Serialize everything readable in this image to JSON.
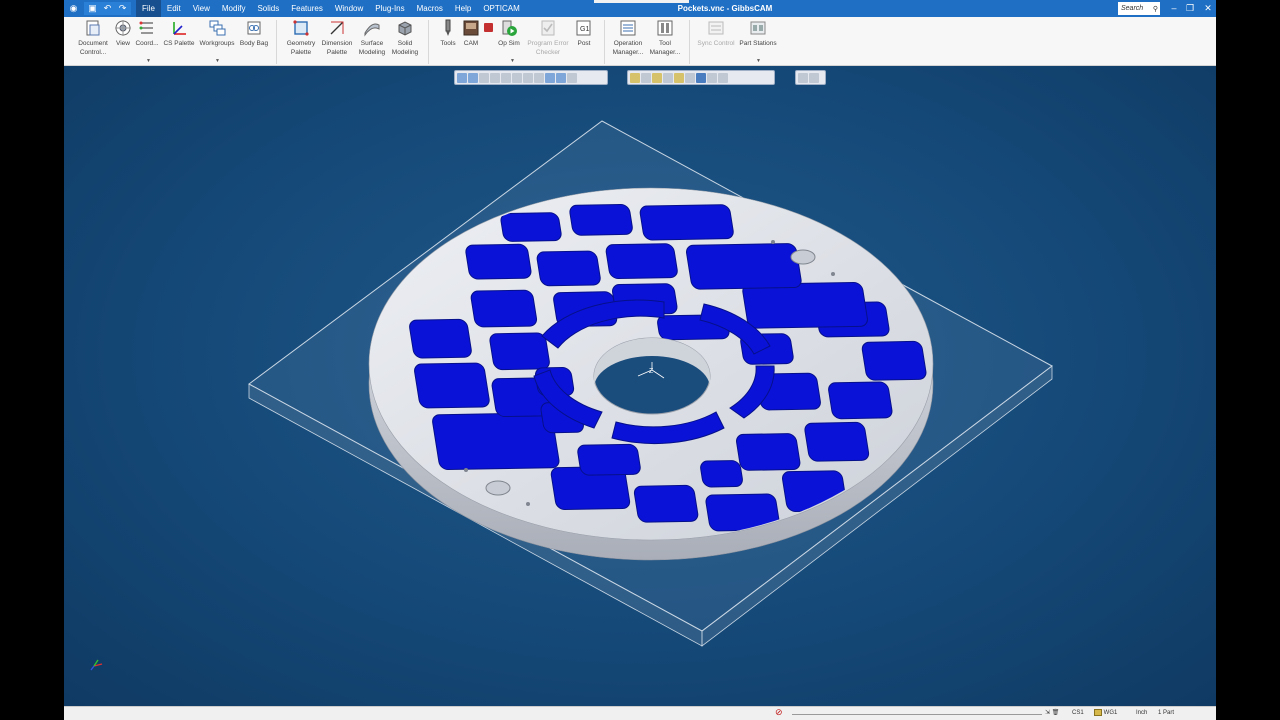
{
  "app": {
    "title": "Pockets.vnc - GibbsCAM",
    "search_placeholder": "Search"
  },
  "menu": [
    "File",
    "Edit",
    "View",
    "Modify",
    "Solids",
    "Features",
    "Window",
    "Plug-Ins",
    "Macros",
    "Help",
    "OPTICAM"
  ],
  "ribbon": {
    "document_control": "Document Control...",
    "view": "View",
    "coord": "Coord...",
    "cs_palette": "CS Palette",
    "workgroups": "Workgroups",
    "body_bag": "Body Bag",
    "geometry_palette": "Geometry Palette",
    "dimension_palette": "Dimension Palette",
    "surface_modeling": "Surface Modeling",
    "solid_modeling": "Solid Modeling",
    "tools": "Tools",
    "cam": "CAM",
    "op_sim": "Op Sim",
    "program_error_checker": "Program Error Checker",
    "post": "Post",
    "operation_manager": "Operation Manager...",
    "tool_manager": "Tool Manager...",
    "sync_control": "Sync Control",
    "part_stations": "Part Stations"
  },
  "status": {
    "cs": "CS1",
    "workgroup": "WG1",
    "units": "Inch",
    "parts": "1 Part"
  },
  "colors": {
    "title_bar": "#1f6fc4",
    "viewport": "#154978",
    "pocket": "#0a12d8",
    "part": "#dfe2ea"
  },
  "icons": [
    "save-icon",
    "undo-icon",
    "redo-icon",
    "search-icon",
    "minimize-icon",
    "restore-icon",
    "close-icon",
    "stop-icon",
    "trash-icon"
  ]
}
